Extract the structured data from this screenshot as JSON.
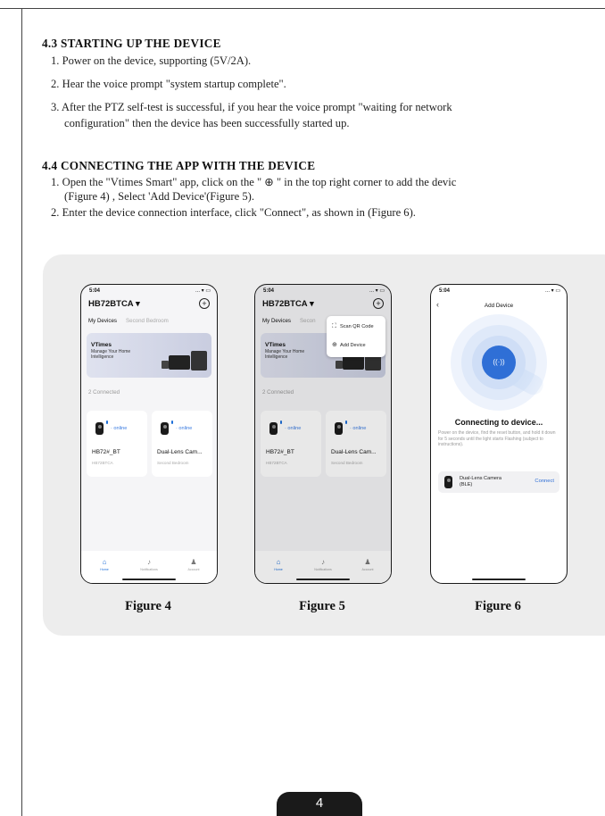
{
  "section_43": {
    "title": "4.3 STARTING UP THE DEVICE",
    "steps": [
      "1. Power on the device, supporting (5V/2A).",
      "2. Hear the voice prompt \"system startup complete\".",
      "3. After the PTZ self-test is successful, if you hear the voice prompt \"waiting for network",
      "configuration\" then the device has been successfully started up."
    ]
  },
  "section_44": {
    "title": "4.4 CONNECTING THE APP WITH THE DEVICE",
    "steps": [
      "1. Open the \"Vtimes Smart\" app, click on the \" ⊕ \" in the top right corner to add the devic",
      "(Figure 4) , Select 'Add Device'(Figure 5).",
      "2. Enter the device connection interface, click \"Connect\", as shown in (Figure 6)."
    ]
  },
  "phone_common": {
    "time": "5:04",
    "status_icons": "... ▾ ▭",
    "home_title": "HB72BTCA ▾",
    "tab_active": "My Devices",
    "tab_inactive": "Second Bedroom",
    "tab_inactive_short": "Secon",
    "banner_title": "VTimes",
    "banner_subtitle": "Manage Your Home Intelligence",
    "connected_label": "2 Connected",
    "devices": [
      {
        "status": "· online",
        "name": "HB72#_BT",
        "room": "HB72BTCA"
      },
      {
        "status": "· online",
        "name": "Dual-Lens Cam...",
        "room": "Second Bedroom"
      }
    ],
    "nav": [
      {
        "icon": "home-icon",
        "label": "Home"
      },
      {
        "icon": "bell-icon",
        "label": "Notifications"
      },
      {
        "icon": "person-icon",
        "label": "Account"
      }
    ]
  },
  "menu": {
    "scan": "Scan QR Code",
    "add": "Add Device"
  },
  "add_device_screen": {
    "title": "Add Device",
    "heading": "Connecting to device...",
    "description": "Power on the device, find the reset button, and hold it down for 5 seconds until the light starts Flashing (subject to instructions).",
    "device_name": "Dual-Lens Camera",
    "device_type": "(BLE)",
    "connect_label": "Connect"
  },
  "figures": {
    "fig4": "Figure 4",
    "fig5": "Figure 5",
    "fig6": "Figure 6"
  },
  "page_number": "4",
  "colors": {
    "accent_blue": "#2f6fd6",
    "panel_gray": "#ededed"
  }
}
